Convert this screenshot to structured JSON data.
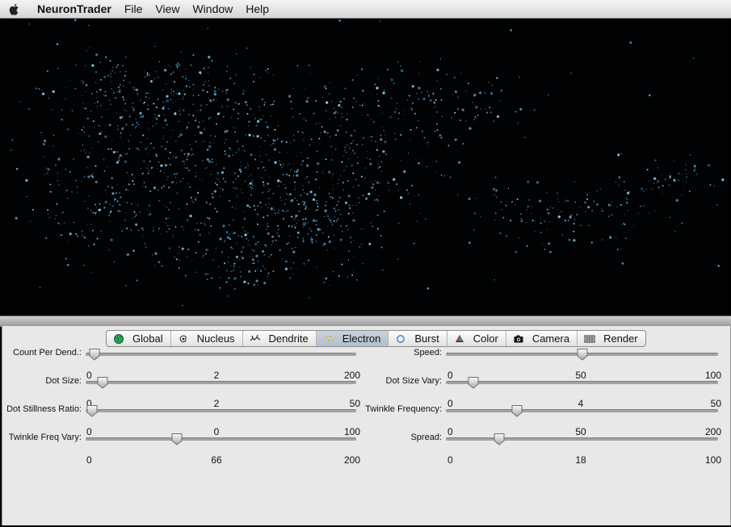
{
  "menubar": {
    "app_name": "NeuronTrader",
    "items": [
      "File",
      "View",
      "Window",
      "Help"
    ]
  },
  "tabs": [
    {
      "label": "Global",
      "icon": "globe-icon",
      "active": false
    },
    {
      "label": "Nucleus",
      "icon": "nucleus-icon",
      "active": false
    },
    {
      "label": "Dendrite",
      "icon": "dendrite-icon",
      "active": false
    },
    {
      "label": "Electron",
      "icon": "electron-icon",
      "active": true
    },
    {
      "label": "Burst",
      "icon": "burst-icon",
      "active": false
    },
    {
      "label": "Color",
      "icon": "color-icon",
      "active": false
    },
    {
      "label": "Camera",
      "icon": "camera-icon",
      "active": false
    },
    {
      "label": "Render",
      "icon": "render-icon",
      "active": false
    }
  ],
  "sliders_left": [
    {
      "label": "Count Per Dend.:",
      "min": "0",
      "value": "2",
      "max": "200",
      "fraction": 0.01
    },
    {
      "label": "Dot Size:",
      "min": "0",
      "value": "2",
      "max": "50",
      "fraction": 0.04
    },
    {
      "label": "Dot Stillness Ratio:",
      "min": "0",
      "value": "0",
      "max": "100",
      "fraction": 0.0
    },
    {
      "label": "Twinkle Freq Vary:",
      "min": "0",
      "value": "66",
      "max": "200",
      "fraction": 0.33
    }
  ],
  "sliders_right": [
    {
      "label": "Speed:",
      "min": "0",
      "value": "50",
      "max": "100",
      "fraction": 0.5
    },
    {
      "label": "Dot Size Vary:",
      "min": "0",
      "value": "4",
      "max": "50",
      "fraction": 0.08
    },
    {
      "label": "Twinkle Frequency:",
      "min": "0",
      "value": "50",
      "max": "200",
      "fraction": 0.25
    },
    {
      "label": "Spread:",
      "min": "0",
      "value": "18",
      "max": "100",
      "fraction": 0.18
    }
  ],
  "colors": {
    "particle_primary": "#7fd4ff",
    "particle_secondary": "#3f8fc4",
    "tab_active": "#b9c4d0"
  }
}
